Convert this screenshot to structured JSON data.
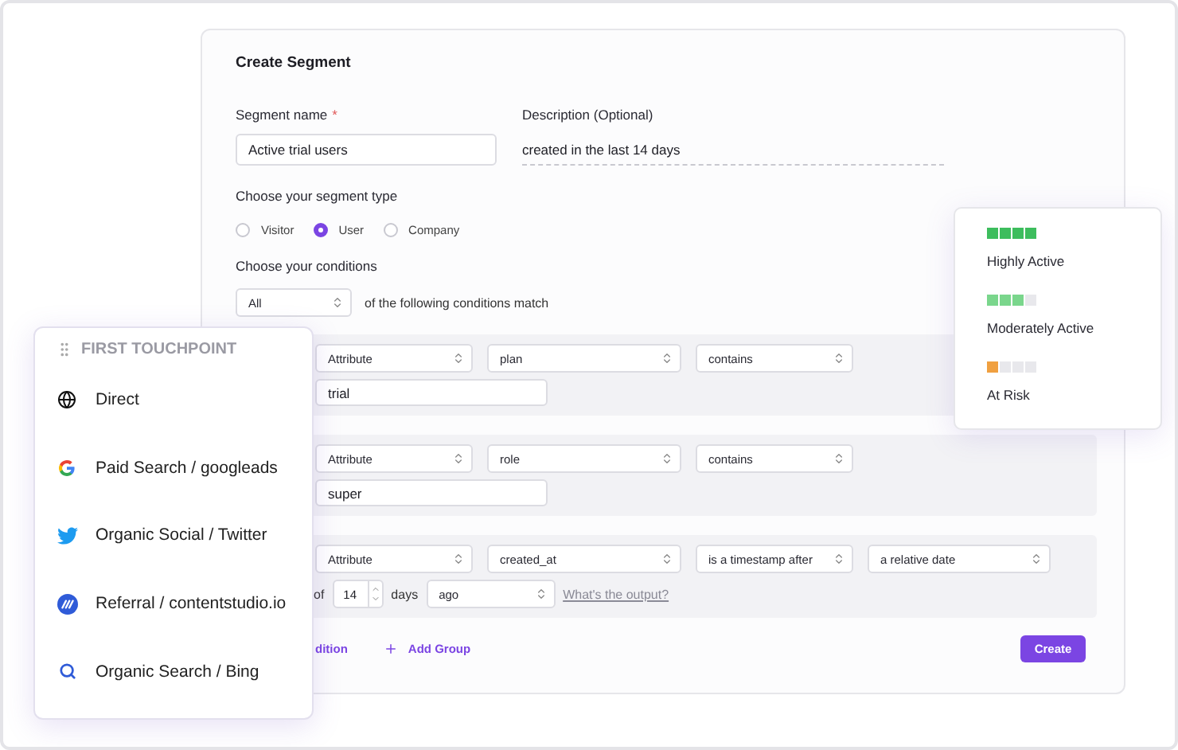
{
  "form": {
    "title": "Create Segment",
    "name_label": "Segment name",
    "required_mark": "*",
    "name_value": "Active trial users",
    "description_label": "Description (Optional)",
    "description_value": "created in the last 14 days",
    "type_label": "Choose your segment type",
    "segment_types": [
      {
        "label": "Visitor",
        "selected": false
      },
      {
        "label": "User",
        "selected": true
      },
      {
        "label": "Company",
        "selected": false
      }
    ],
    "conditions_label": "Choose your conditions",
    "match_select": "All",
    "match_text": "of the following conditions match",
    "conditions": [
      {
        "selects": [
          "Attribute",
          "plan",
          "contains"
        ],
        "value": "trial"
      },
      {
        "selects": [
          "Attribute",
          "role",
          "contains"
        ],
        "value": "super"
      },
      {
        "selects": [
          "Attribute",
          "created_at",
          "is a timestamp after",
          "a relative date"
        ],
        "relative": {
          "prefix": "of",
          "number": "14",
          "unit": "days",
          "direction": "ago",
          "link": "What's the output?"
        }
      }
    ],
    "add_condition": "dition",
    "add_group": "Add Group",
    "create_button": "Create"
  },
  "touchpoint": {
    "title": "FIRST TOUCHPOINT",
    "items": [
      {
        "kind": "globe",
        "label": "Direct"
      },
      {
        "kind": "google",
        "label": "Paid Search / googleads"
      },
      {
        "kind": "twitter",
        "label": "Organic Social / Twitter"
      },
      {
        "kind": "referral",
        "label": "Referral / contentstudio.io"
      },
      {
        "kind": "search",
        "label": "Organic Search / Bing"
      }
    ]
  },
  "activity": {
    "levels": [
      {
        "label": "Highly Active",
        "level": 1,
        "color": "#3dbd5d"
      },
      {
        "label": "Moderately Active",
        "level": 0.75,
        "color": "#7ad68c"
      },
      {
        "label": "At Risk",
        "level": 0.25,
        "color": "#f0a040"
      }
    ]
  }
}
